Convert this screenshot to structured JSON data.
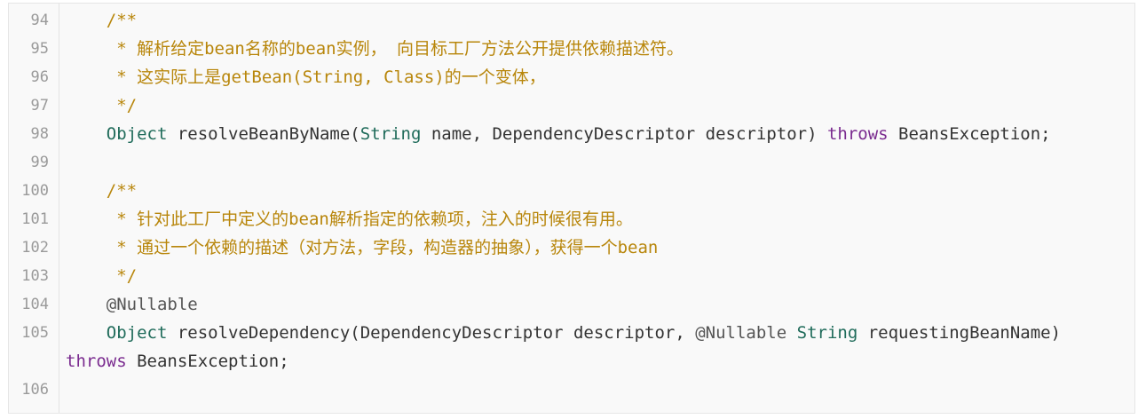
{
  "code_block": {
    "lines": [
      {
        "no": "94",
        "parts": [
          {
            "t": "    /**",
            "c": "comment"
          }
        ]
      },
      {
        "no": "95",
        "parts": [
          {
            "t": "     * 解析给定bean名称的bean实例， 向目标工厂方法公开提供依赖描述符。",
            "c": "comment"
          }
        ]
      },
      {
        "no": "96",
        "parts": [
          {
            "t": "     * 这实际上是getBean(String, Class)的一个变体，",
            "c": "comment"
          }
        ]
      },
      {
        "no": "97",
        "parts": [
          {
            "t": "     */",
            "c": "comment"
          }
        ]
      },
      {
        "no": "98",
        "parts": [
          {
            "t": "    ",
            "c": "plain"
          },
          {
            "t": "Object",
            "c": "type"
          },
          {
            "t": " resolveBeanByName(",
            "c": "plain"
          },
          {
            "t": "String",
            "c": "type"
          },
          {
            "t": " name, DependencyDescriptor descriptor) ",
            "c": "plain"
          },
          {
            "t": "throws",
            "c": "kw"
          },
          {
            "t": " BeansException;",
            "c": "plain"
          }
        ]
      },
      {
        "no": "99",
        "parts": []
      },
      {
        "no": "100",
        "parts": [
          {
            "t": "    /**",
            "c": "comment"
          }
        ]
      },
      {
        "no": "101",
        "parts": [
          {
            "t": "     * 针对此工厂中定义的bean解析指定的依赖项，注入的时候很有用。",
            "c": "comment"
          }
        ]
      },
      {
        "no": "102",
        "parts": [
          {
            "t": "     * 通过一个依赖的描述（对方法，字段，构造器的抽象），获得一个bean",
            "c": "comment"
          }
        ]
      },
      {
        "no": "103",
        "parts": [
          {
            "t": "     */",
            "c": "comment"
          }
        ]
      },
      {
        "no": "104",
        "parts": [
          {
            "t": "    ",
            "c": "plain"
          },
          {
            "t": "@Nullable",
            "c": "anno"
          }
        ]
      },
      {
        "no": "105",
        "wrapped": true,
        "parts": [
          {
            "t": "    ",
            "c": "plain"
          },
          {
            "t": "Object",
            "c": "type"
          },
          {
            "t": " resolveDependency(DependencyDescriptor descriptor, ",
            "c": "plain"
          },
          {
            "t": "@Nullable",
            "c": "anno"
          },
          {
            "t": " ",
            "c": "plain"
          },
          {
            "t": "String",
            "c": "type"
          },
          {
            "t": " requestingBeanName)\n",
            "c": "plain"
          },
          {
            "t": "throws",
            "c": "kw"
          },
          {
            "t": " BeansException;",
            "c": "plain"
          }
        ]
      },
      {
        "no": "106",
        "parts": []
      }
    ]
  },
  "colors": {
    "comment": "#b8860b",
    "keyword": "#7a2b8f",
    "type": "#1f6b5a",
    "annotation": "#555555",
    "plain": "#333333",
    "line_number": "#9a9a9a",
    "background": "#f9f9f9"
  }
}
